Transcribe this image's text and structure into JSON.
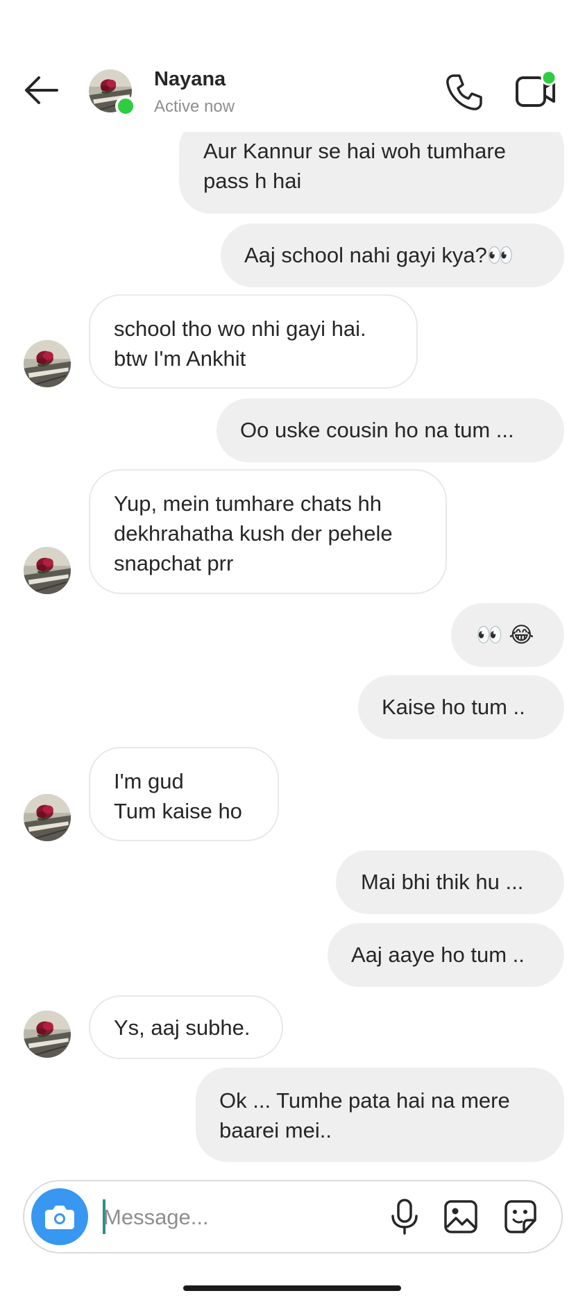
{
  "header": {
    "name": "Nayana",
    "status": "Active now"
  },
  "messages": [
    {
      "id": "m1",
      "direction": "outgoing",
      "text": "Aur Kannur se hai woh tumhare\npass h hai"
    },
    {
      "id": "m2",
      "direction": "outgoing",
      "text": "Aaj school nahi gayi kya?👀"
    },
    {
      "id": "m3",
      "direction": "incoming",
      "text": "school tho wo nhi gayi hai.\n btw I'm Ankhit"
    },
    {
      "id": "m4",
      "direction": "outgoing",
      "text": "Oo uske cousin ho na tum ..."
    },
    {
      "id": "m5",
      "direction": "incoming",
      "text": "Yup, mein tumhare chats hh\ndekhrahatha kush der pehele\nsnapchat prr"
    },
    {
      "id": "m6",
      "direction": "outgoing",
      "text": "👀 😂"
    },
    {
      "id": "m7",
      "direction": "outgoing",
      "text": "Kaise ho tum .."
    },
    {
      "id": "m8",
      "direction": "incoming",
      "text": "I'm gud\nTum kaise ho"
    },
    {
      "id": "m9",
      "direction": "outgoing",
      "text": "Mai bhi thik hu ..."
    },
    {
      "id": "m10",
      "direction": "outgoing",
      "text": "Aaj aaye ho tum .."
    },
    {
      "id": "m11",
      "direction": "incoming",
      "text": "Ys, aaj subhe."
    },
    {
      "id": "m12",
      "direction": "outgoing",
      "text": "Ok ... Tumhe pata hai na mere\nbaarei mei.."
    }
  ],
  "composer": {
    "placeholder": "Message...",
    "value": ""
  },
  "icons": {
    "back": "arrow-left-icon",
    "call": "phone-icon",
    "video": "video-camera-icon",
    "camera": "camera-icon",
    "mic": "microphone-icon",
    "gallery": "image-icon",
    "sticker": "sticker-icon"
  },
  "colors": {
    "online": "#2ecc40",
    "accent": "#3897f0",
    "outgoing_bubble": "#efefef",
    "incoming_border": "#e8e8e8"
  }
}
